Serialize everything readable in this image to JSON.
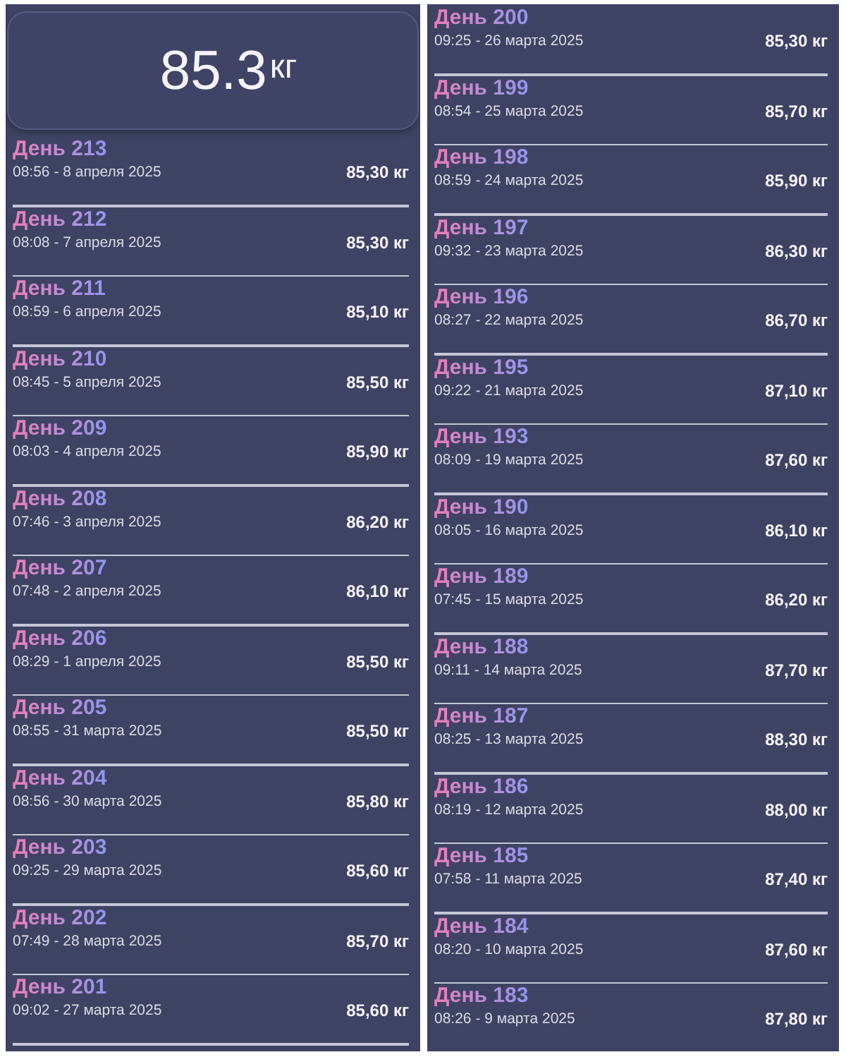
{
  "panels": [
    {
      "summary": {
        "value": "85.3",
        "unit": "кг"
      },
      "entries": [
        {
          "title": "День 213",
          "datetime": "08:56 - 8 апреля 2025",
          "weight": "85,30 кг"
        },
        {
          "title": "День 212",
          "datetime": "08:08 - 7 апреля 2025",
          "weight": "85,30 кг"
        },
        {
          "title": "День 211",
          "datetime": "08:59 - 6 апреля 2025",
          "weight": "85,10 кг"
        },
        {
          "title": "День 210",
          "datetime": "08:45 - 5 апреля 2025",
          "weight": "85,50 кг"
        },
        {
          "title": "День 209",
          "datetime": "08:03 - 4 апреля 2025",
          "weight": "85,90 кг"
        },
        {
          "title": "День 208",
          "datetime": "07:46 - 3 апреля 2025",
          "weight": "86,20 кг"
        },
        {
          "title": "День 207",
          "datetime": "07:48 - 2 апреля 2025",
          "weight": "86,10 кг"
        },
        {
          "title": "День 206",
          "datetime": "08:29 - 1 апреля 2025",
          "weight": "85,50 кг"
        },
        {
          "title": "День 205",
          "datetime": "08:55 - 31 марта 2025",
          "weight": "85,50 кг"
        },
        {
          "title": "День 204",
          "datetime": "08:56 - 30 марта 2025",
          "weight": "85,80 кг"
        },
        {
          "title": "День 203",
          "datetime": "09:25 - 29 марта 2025",
          "weight": "85,60 кг"
        },
        {
          "title": "День 202",
          "datetime": "07:49 - 28 марта 2025",
          "weight": "85,70 кг"
        },
        {
          "title": "День 201",
          "datetime": "09:02 - 27 марта 2025",
          "weight": "85,60 кг"
        }
      ]
    },
    {
      "entries": [
        {
          "title": "День 200",
          "datetime": "09:25 - 26 марта 2025",
          "weight": "85,30 кг"
        },
        {
          "title": "День 199",
          "datetime": "08:54 - 25 марта 2025",
          "weight": "85,70 кг"
        },
        {
          "title": "День 198",
          "datetime": "08:59 - 24 марта 2025",
          "weight": "85,90 кг"
        },
        {
          "title": "День 197",
          "datetime": "09:32 - 23 марта 2025",
          "weight": "86,30 кг"
        },
        {
          "title": "День 196",
          "datetime": "08:27 - 22 марта 2025",
          "weight": "86,70 кг"
        },
        {
          "title": "День 195",
          "datetime": "09:22 - 21 марта 2025",
          "weight": "87,10 кг"
        },
        {
          "title": "День 193",
          "datetime": "08:09 - 19 марта 2025",
          "weight": "87,60 кг"
        },
        {
          "title": "День 190",
          "datetime": "08:05 - 16 марта 2025",
          "weight": "86,10 кг"
        },
        {
          "title": "День 189",
          "datetime": "07:45 - 15 марта 2025",
          "weight": "86,20 кг"
        },
        {
          "title": "День 188",
          "datetime": "09:11 - 14 марта 2025",
          "weight": "87,70 кг"
        },
        {
          "title": "День 187",
          "datetime": "08:25 - 13 марта 2025",
          "weight": "88,30 кг"
        },
        {
          "title": "День 186",
          "datetime": "08:19 - 12 марта 2025",
          "weight": "88,00 кг"
        },
        {
          "title": "День 185",
          "datetime": "07:58 - 11 марта 2025",
          "weight": "87,40 кг"
        },
        {
          "title": "День 184",
          "datetime": "08:20 - 10 марта 2025",
          "weight": "87,60 кг"
        },
        {
          "title": "День 183",
          "datetime": "08:26 - 9 марта 2025",
          "weight": "87,80 кг"
        }
      ]
    }
  ]
}
